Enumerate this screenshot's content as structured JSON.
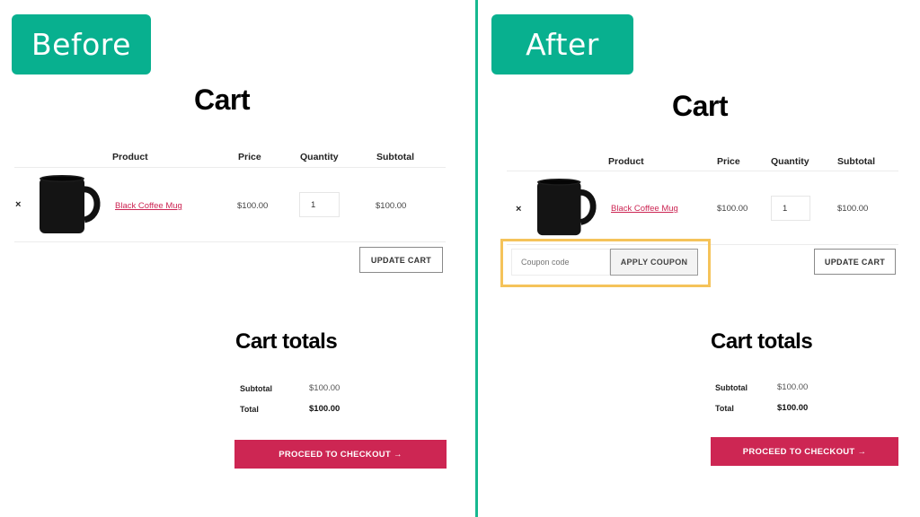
{
  "colors": {
    "accent_green": "#08b08f",
    "divider": "#17b890",
    "checkout_red": "#cd2653",
    "product_link": "#cc2553",
    "highlight": "#f5c35a"
  },
  "before": {
    "tag_label": "Before",
    "title": "Cart",
    "columns": [
      "Product",
      "Price",
      "Quantity",
      "Subtotal"
    ],
    "items": [
      {
        "remove": "×",
        "image": "black-coffee-mug-image",
        "name": "Black Coffee Mug",
        "price": "$100.00",
        "quantity": "1",
        "subtotal": "$100.00"
      }
    ],
    "update_cart_label": "UPDATE CART",
    "totals": {
      "title": "Cart totals",
      "subtotal_label": "Subtotal",
      "subtotal_value": "$100.00",
      "total_label": "Total",
      "total_value": "$100.00"
    },
    "checkout_label": "PROCEED TO CHECKOUT →"
  },
  "after": {
    "tag_label": "After",
    "title": "Cart",
    "columns": [
      "Product",
      "Price",
      "Quantity",
      "Subtotal"
    ],
    "items": [
      {
        "remove": "×",
        "image": "black-coffee-mug-image",
        "name": "Black Coffee Mug",
        "price": "$100.00",
        "quantity": "1",
        "subtotal": "$100.00"
      }
    ],
    "coupon": {
      "placeholder": "Coupon code",
      "apply_label": "APPLY COUPON"
    },
    "update_cart_label": "UPDATE CART",
    "totals": {
      "title": "Cart totals",
      "subtotal_label": "Subtotal",
      "subtotal_value": "$100.00",
      "total_label": "Total",
      "total_value": "$100.00"
    },
    "checkout_label": "PROCEED TO CHECKOUT →"
  }
}
